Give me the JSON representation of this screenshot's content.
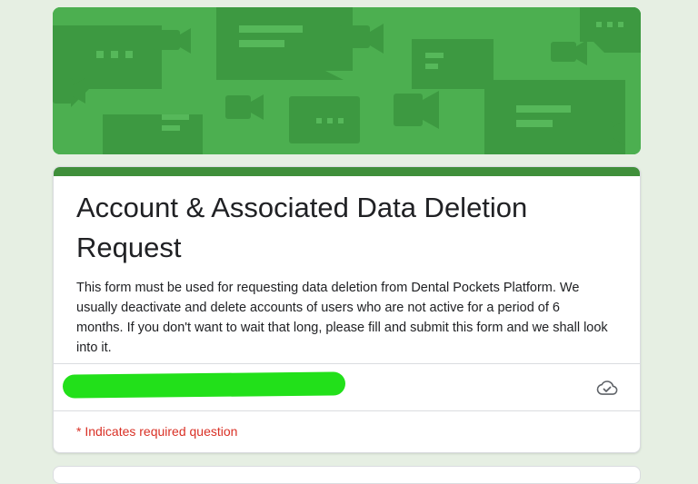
{
  "header": {
    "banner_icon": "chat-video-pattern",
    "color": "#4caf50"
  },
  "form": {
    "accent_color": "#3f8f3a",
    "title": "Account & Associated Data Deletion Request",
    "description": "This form must be used for requesting data deletion from Dental Pockets Platform. We usually deactivate and delete accounts of users who are not active for a period of 6 months. If you don't want to wait that long, please fill and submit this form and we shall look into it.",
    "account": {
      "redaction_color": "#22e01a",
      "status_icon": "cloud-done-icon"
    },
    "required_note": "* Indicates required question",
    "required_color": "#d93025"
  }
}
